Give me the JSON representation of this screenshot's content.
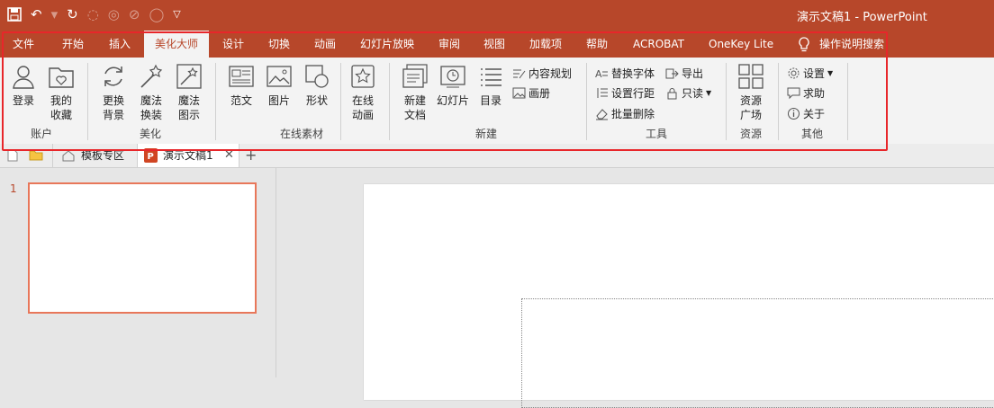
{
  "title_bar": {
    "document_title": "演示文稿1  -  PowerPoint",
    "quick_access": [
      "save-icon",
      "undo-icon",
      "redo-icon",
      "circle-icon",
      "circle-icon",
      "circle-icon",
      "circle-icon",
      "customize-dropdown-icon"
    ]
  },
  "tabs": [
    {
      "label": "文件"
    },
    {
      "label": "开始"
    },
    {
      "label": "插入"
    },
    {
      "label": "美化大师",
      "active": true
    },
    {
      "label": "设计"
    },
    {
      "label": "切换"
    },
    {
      "label": "动画"
    },
    {
      "label": "幻灯片放映"
    },
    {
      "label": "审阅"
    },
    {
      "label": "视图"
    },
    {
      "label": "加载项"
    },
    {
      "label": "帮助"
    },
    {
      "label": "ACROBAT"
    },
    {
      "label": "OneKey Lite"
    },
    {
      "label": "操作说明搜索"
    }
  ],
  "ribbon": {
    "groups": {
      "account": {
        "label": "账户",
        "buttons": [
          {
            "label": "登录"
          },
          {
            "label": "我的\n收藏"
          }
        ]
      },
      "beautify": {
        "label": "美化",
        "buttons": [
          {
            "label": "更换\n背景"
          },
          {
            "label": "魔法\n换装"
          },
          {
            "label": "魔法\n图示"
          }
        ]
      },
      "online": {
        "label": "在线素材",
        "buttons": [
          {
            "label": "范文"
          },
          {
            "label": "图片"
          },
          {
            "label": "形状"
          },
          {
            "label": "在线\n动画"
          }
        ]
      },
      "new": {
        "label": "新建",
        "buttons": [
          {
            "label": "新建\n文档"
          },
          {
            "label": "幻灯片"
          },
          {
            "label": "目录"
          }
        ],
        "small": [
          {
            "label": "内容规划"
          },
          {
            "label": "画册"
          }
        ]
      },
      "tools": {
        "label": "工具",
        "small": [
          {
            "label": "替换字体"
          },
          {
            "label": "设置行距"
          },
          {
            "label": "批量删除"
          },
          {
            "label": "导出"
          },
          {
            "label": "只读"
          }
        ]
      },
      "resources": {
        "label": "资源",
        "buttons": [
          {
            "label": "资源\n广场"
          }
        ]
      },
      "other": {
        "label": "其他",
        "small": [
          {
            "label": "设置"
          },
          {
            "label": "求助"
          },
          {
            "label": "关于"
          }
        ]
      }
    }
  },
  "doc_tabs": [
    {
      "label": "模板专区"
    },
    {
      "label": "演示文稿1",
      "active": true
    },
    {
      "label": "+"
    }
  ],
  "slides_panel": {
    "slide_number": "1"
  },
  "colors": {
    "accent": "#b7472a",
    "highlight": "#e8262a",
    "thumb_border": "#e8775a"
  }
}
